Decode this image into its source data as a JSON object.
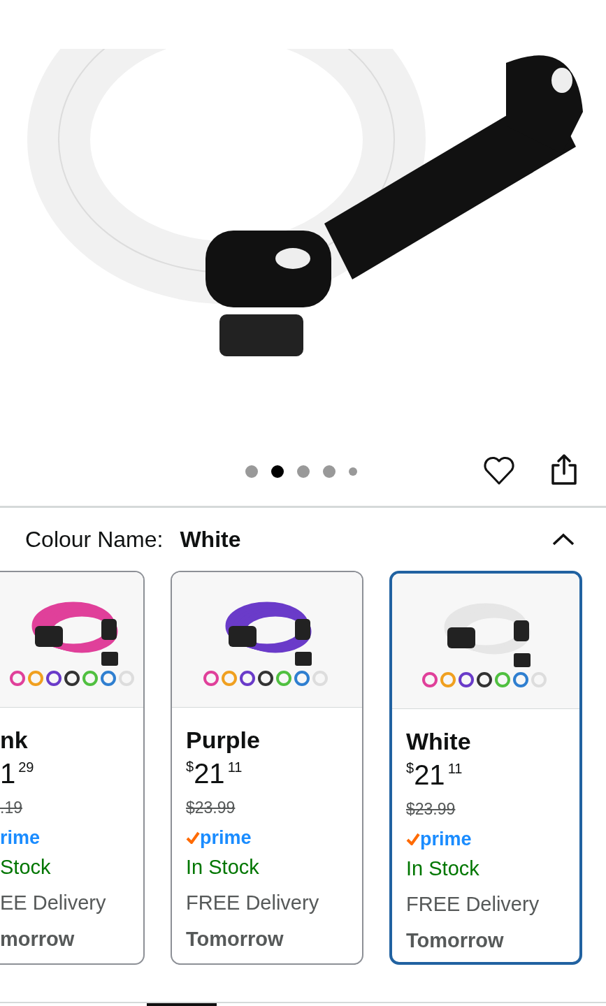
{
  "gallery": {
    "dots": [
      {
        "selected": false
      },
      {
        "selected": true
      },
      {
        "selected": false
      },
      {
        "selected": false
      },
      {
        "selected": false,
        "kind": "small"
      }
    ]
  },
  "variation": {
    "label": "Colour Name:",
    "value": "White",
    "expanded": true
  },
  "cards": [
    {
      "name": "nk",
      "color": "#e0409a",
      "price": {
        "whole": "1",
        "fraction": "29"
      },
      "list_price": ".19",
      "prime": {
        "text": "rime",
        "check": false
      },
      "stock": "Stock",
      "delivery": "EE Delivery",
      "delivery_day": "morrow",
      "selected": false,
      "clipped": true
    },
    {
      "name": "Purple",
      "color": "#6a3bc9",
      "price": {
        "currency": "$",
        "whole": "21",
        "fraction": "11"
      },
      "list_price": "$23.99",
      "prime": {
        "text": "prime",
        "check": true
      },
      "stock": "In Stock",
      "delivery": "FREE Delivery",
      "delivery_day": "Tomorrow",
      "selected": false,
      "clipped": false
    },
    {
      "name": "White",
      "color": "#e6e6e6",
      "price": {
        "currency": "$",
        "whole": "21",
        "fraction": "11"
      },
      "list_price": "$23.99",
      "prime": {
        "text": "prime",
        "check": true
      },
      "stock": "In Stock",
      "delivery": "FREE Delivery",
      "delivery_day": "Tomorrow",
      "selected": true,
      "clipped": false
    }
  ]
}
